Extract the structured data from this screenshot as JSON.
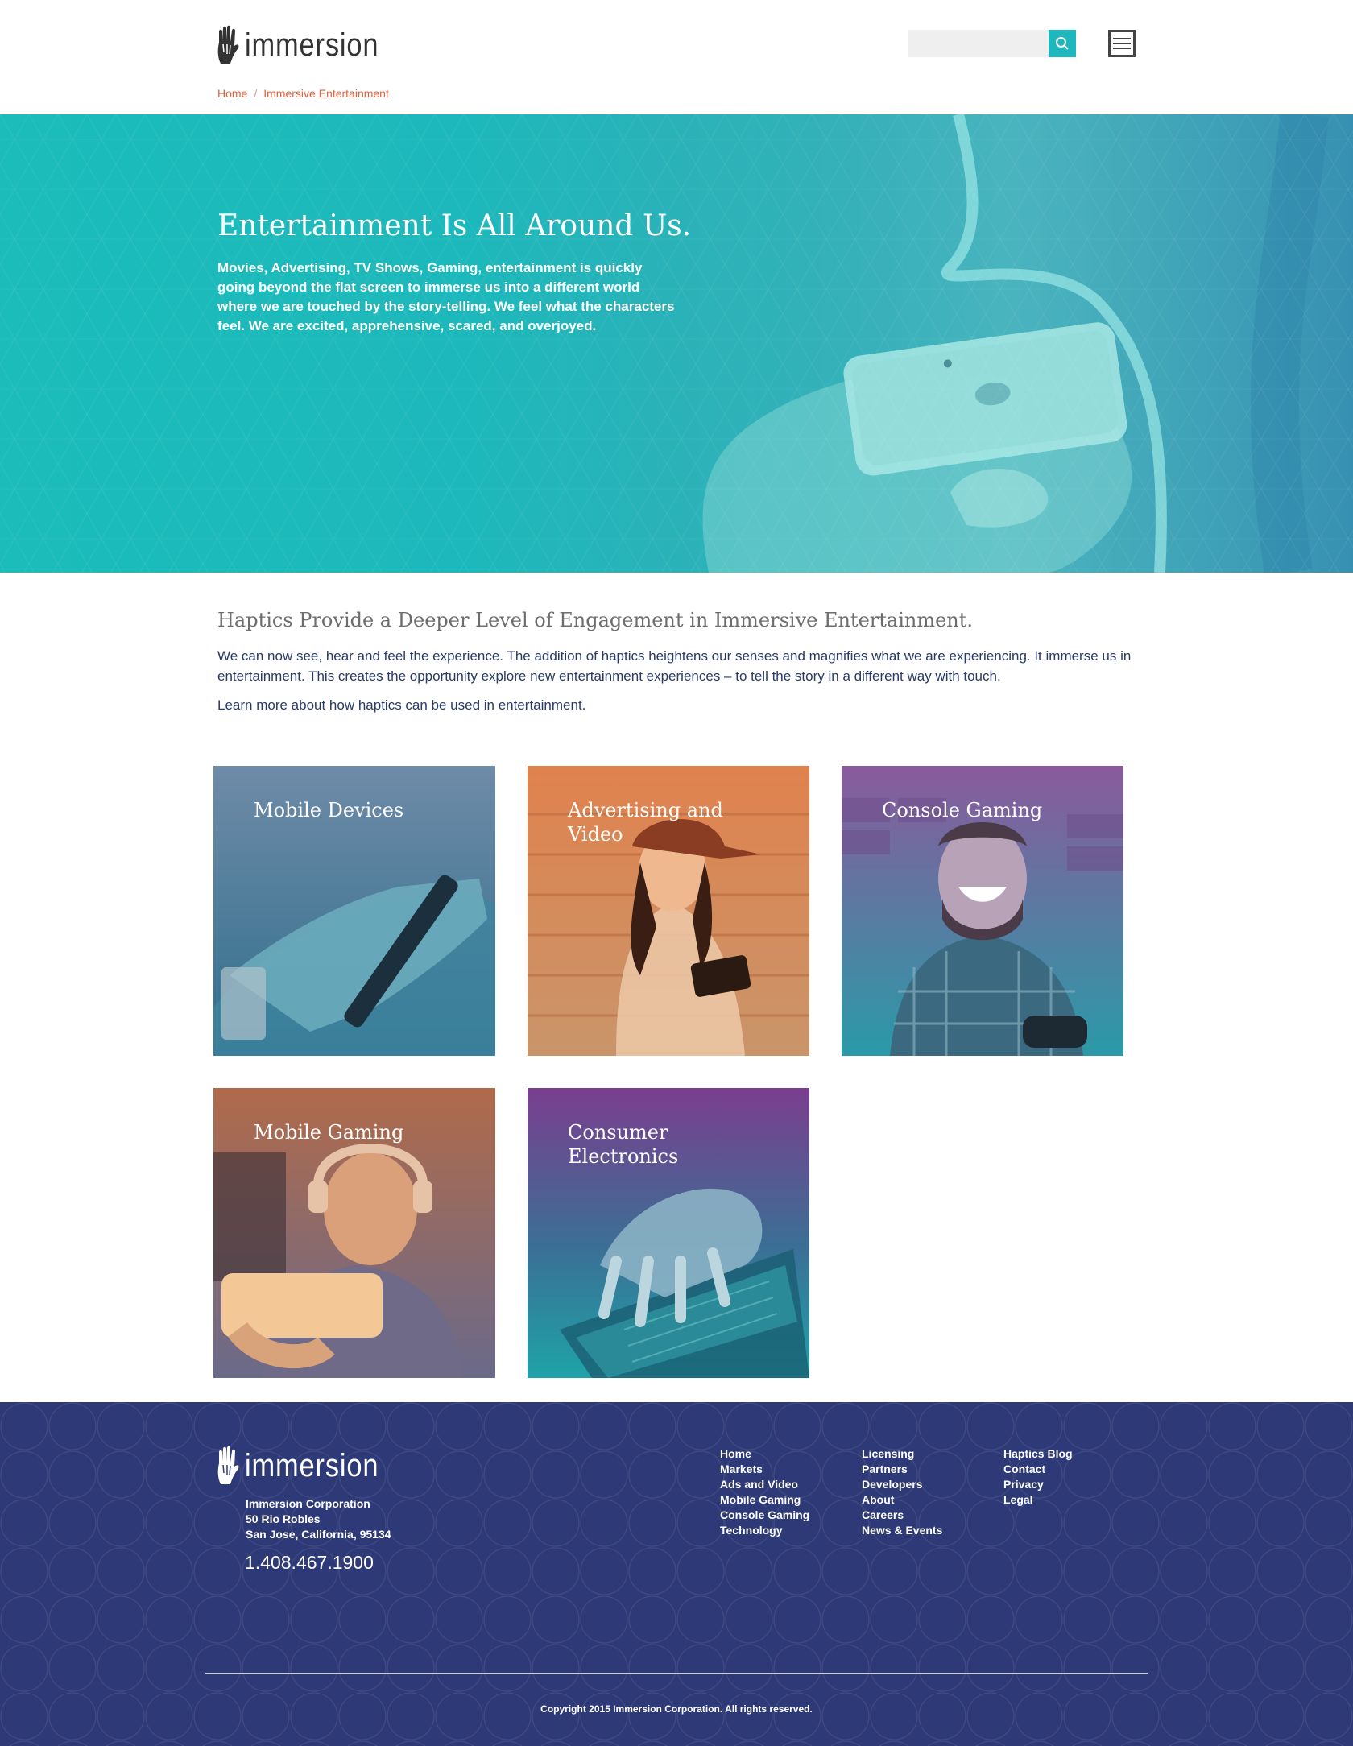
{
  "header": {
    "logo_text": "immersion",
    "search_placeholder": "",
    "breadcrumb": {
      "home": "Home",
      "separator": "/",
      "current": "Immersive Entertainment"
    }
  },
  "hero": {
    "title": "Entertainment Is All Around Us.",
    "text": "Movies, Advertising, TV Shows, Gaming, entertainment is quickly going beyond the flat screen to immerse us into a different world where we are touched by the story-telling.  We feel what the characters feel.  We are excited, apprehensive, scared, and overjoyed."
  },
  "intro": {
    "title": "Haptics Provide a Deeper Level of Engagement in Immersive Entertainment.",
    "paragraph": "We can now see, hear and feel the experience. The addition of haptics heightens our senses and magnifies what we are experiencing. It immerse us in entertainment. This creates the opportunity explore new entertainment experiences – to tell the story in a different way with touch.",
    "learn_more": "Learn more about how haptics can be used in entertainment."
  },
  "tiles": [
    {
      "label": "Mobile Devices"
    },
    {
      "label": "Advertising and Video"
    },
    {
      "label": "Console Gaming"
    },
    {
      "label": "Mobile Gaming"
    },
    {
      "label": "Consumer Electronics"
    }
  ],
  "footer": {
    "logo_text": "immersion",
    "company": "Immersion Corporation",
    "street": "50 Rio Robles",
    "city": "San Jose, California, 95134",
    "phone": "1.408.467.1900",
    "col1": [
      "Home",
      "Markets",
      "Ads and Video",
      "Mobile Gaming",
      "Console Gaming",
      "Technology"
    ],
    "col2": [
      "Licensing",
      "Partners",
      "Developers",
      "About",
      "Careers",
      "News & Events"
    ],
    "col3": [
      "Haptics Blog",
      "Contact",
      "Privacy",
      "Legal"
    ],
    "copyright": "Copyright 2015 Immersion Corporation. All rights reserved."
  },
  "colors": {
    "accent_teal": "#1eb7bd",
    "breadcrumb_orange": "#e4603b",
    "footer_navy": "#2e3a78",
    "text_navy": "#283a66"
  }
}
